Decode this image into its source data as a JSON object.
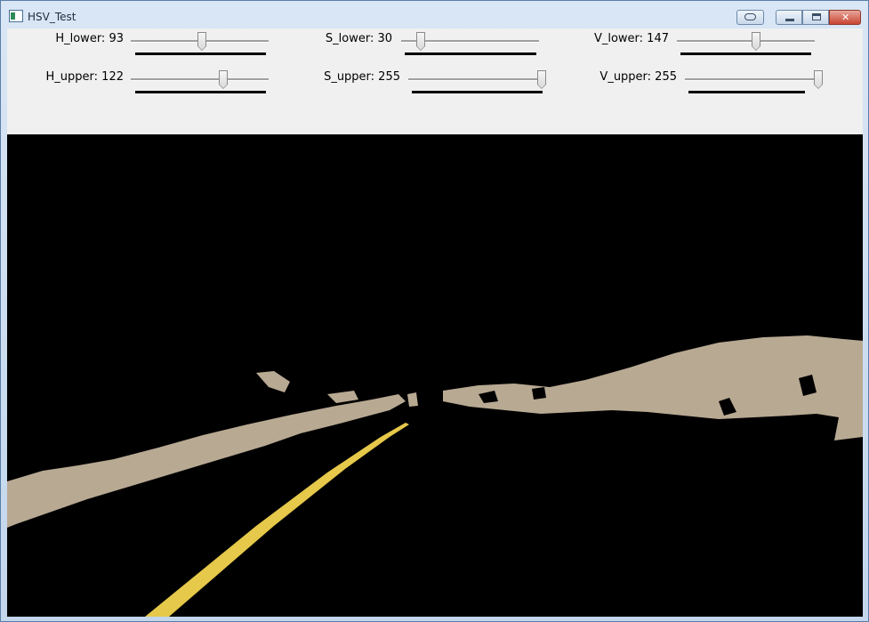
{
  "window": {
    "title": "HSV_Test",
    "close_glyph": "✕"
  },
  "sliders": [
    {
      "name": "H_lower",
      "label": "H_lower: 93",
      "value": 93,
      "max": 179
    },
    {
      "name": "S_lower",
      "label": "S_lower: 30",
      "value": 30,
      "max": 255
    },
    {
      "name": "V_lower",
      "label": "V_lower: 147",
      "value": 147,
      "max": 255
    },
    {
      "name": "H_upper",
      "label": "H_upper: 122",
      "value": 122,
      "max": 179
    },
    {
      "name": "S_upper",
      "label": "S_upper: 255",
      "value": 255,
      "max": 255
    },
    {
      "name": "V_upper",
      "label": "V_upper: 255",
      "value": 255,
      "max": 255
    }
  ],
  "colors": {
    "mask_background": "#000000",
    "terrain": "#b8a993",
    "lane_line": "#e6c84a",
    "panel": "#f0f0f0"
  },
  "icons": {
    "app": "window-app-icon",
    "extra": "resize-icon",
    "minimize": "minimize-icon",
    "maximize": "maximize-icon",
    "close": "close-icon"
  }
}
